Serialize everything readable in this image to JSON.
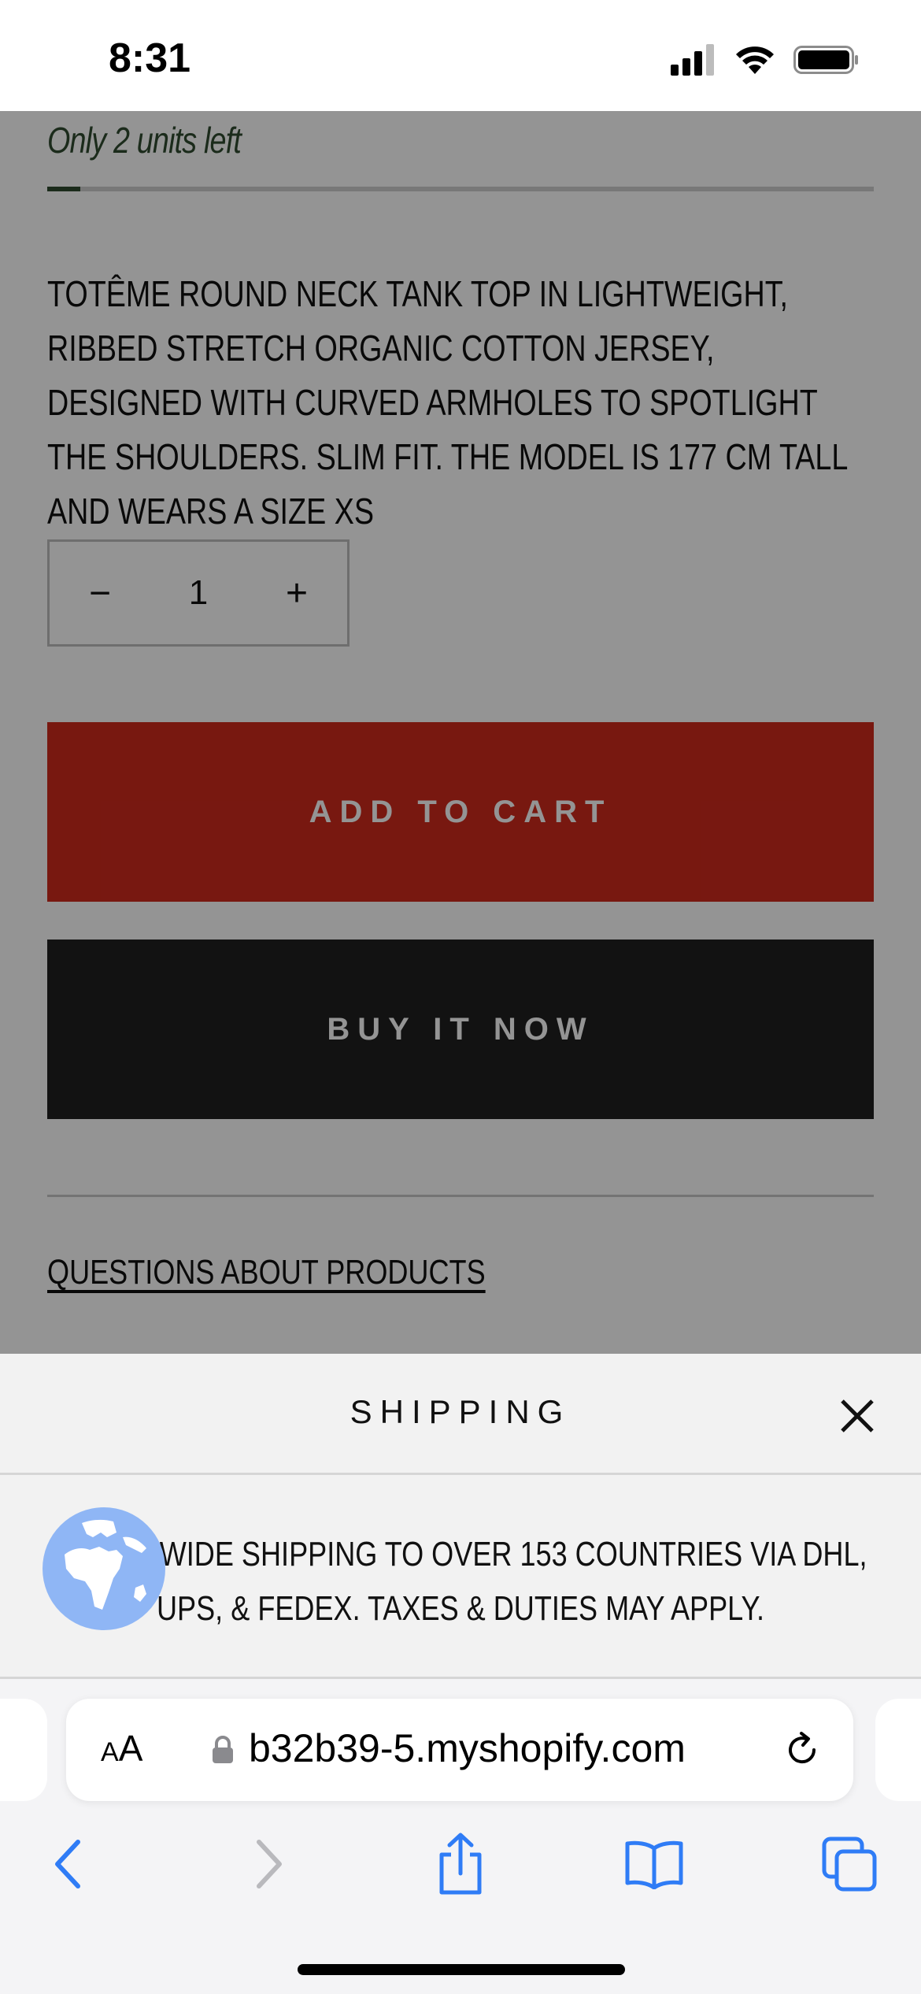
{
  "status_bar": {
    "time": "8:31"
  },
  "product": {
    "stock_note": "Only 2 units left",
    "stock_fraction": 0.04,
    "description": "TOTÊME ROUND NECK TANK TOP IN LIGHTWEIGHT, RIBBED STRETCH ORGANIC COTTON JERSEY, DESIGNED WITH CURVED ARMHOLES TO SPOTLIGHT THE SHOULDERS. SLIM FIT. THE MODEL IS 177 CM TALL AND WEARS A SIZE XS",
    "quantity": {
      "minus": "−",
      "value": "1",
      "plus": "+"
    },
    "add_to_cart": "ADD TO CART",
    "buy_now": "BUY IT NOW",
    "questions_link": "QUESTIONS ABOUT PRODUCTS"
  },
  "shipping_sheet": {
    "title": "SHIPPING",
    "body": "WORLDWIDE SHIPPING TO OVER 153 COUNTRIES VIA DHL, UPS, & FEDEX. TAXES & DUTIES MAY APPLY."
  },
  "browser": {
    "aa_small": "A",
    "aa_large": "A",
    "url": "b32b39-5.myshopify.com"
  },
  "colors": {
    "add_to_cart_bg": "#cf2a1d",
    "buy_now_bg": "#1f1f1f",
    "stock_accent": "#2f4a30",
    "safari_blue": "#2f7cf6"
  }
}
